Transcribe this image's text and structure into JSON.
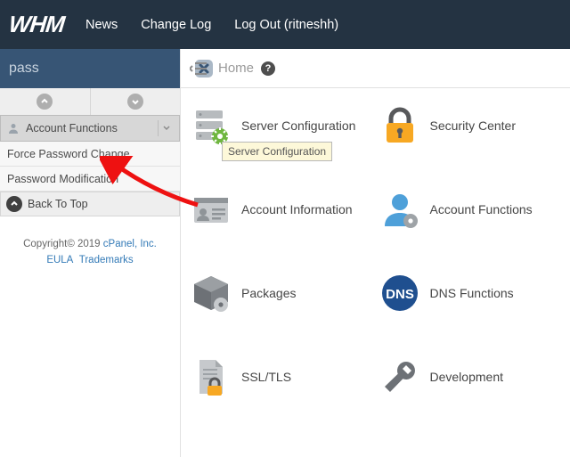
{
  "nav": {
    "logo": "WHM",
    "items": [
      "News",
      "Change Log",
      "Log Out (ritneshh)"
    ]
  },
  "sidebar": {
    "searchValue": "pass",
    "sectionTitle": "Account Functions",
    "links": [
      "Force Password Change",
      "Password Modification"
    ],
    "backTop": "Back To Top",
    "footerPrefix": "Copyright© 2019 ",
    "footerLink1": "cPanel, Inc.",
    "footerLink2": "EULA",
    "footerLink3": "Trademarks"
  },
  "breadcrumb": {
    "label": "Home"
  },
  "tiles": [
    {
      "label": "Server Configuration",
      "tooltip": "Server Configuration"
    },
    {
      "label": "Security Center"
    },
    {
      "label": "Account Information"
    },
    {
      "label": "Account Functions"
    },
    {
      "label": "Packages"
    },
    {
      "label": "DNS Functions"
    },
    {
      "label": "SSL/TLS"
    },
    {
      "label": "Development"
    }
  ]
}
